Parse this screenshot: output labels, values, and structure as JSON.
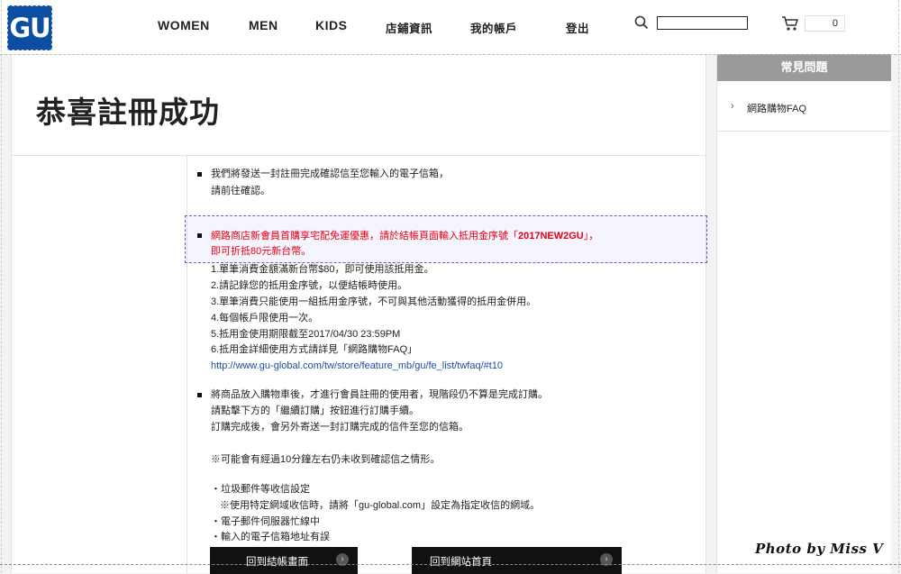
{
  "header": {
    "logo": "GU",
    "nav": [
      "WOMEN",
      "MEN",
      "KIDS",
      "店鋪資訊",
      "我的帳戶",
      "登出"
    ],
    "search_placeholder": "",
    "cart_count": "0"
  },
  "page_title": "恭喜註冊成功",
  "notice1": {
    "lines": [
      "我們將發送一封註冊完成確認信至您輸入的電子信箱，",
      "請前往確認。"
    ]
  },
  "promo": {
    "line1_prefix": "網路商店新會員首購享宅配免運優惠，請於結帳頁面輸入抵用金序號「",
    "code": "2017NEW2GU",
    "line1_suffix": "」，",
    "line2": "即可折抵80元新台幣。"
  },
  "rules": [
    "1.單筆消費金額滿新台幣$80，即可使用該抵用金。",
    "2.請記錄您的抵用金序號，以便結帳時使用。",
    "3.單筆消費只能使用一組抵用金序號，不可與其他活動獲得的抵用金併用。",
    "4.每個帳戶限使用一次。",
    "5.抵用金使用期限截至2017/04/30 23:59PM",
    "6.抵用金詳細使用方式請詳見「網路購物FAQ」"
  ],
  "faq_link": "http://www.gu-global.com/tw/store/feature_mb/gu/fe_list/twfaq/#t10",
  "notice3": {
    "lines": [
      "將商品放入購物車後，才進行會員註冊的使用者，現階段仍不算是完成訂購。",
      "請點擊下方的「繼續訂購」按鈕進行訂購手續。",
      "訂購完成後，會另外寄送一封訂購完成的信件至您的信箱。"
    ]
  },
  "warning": "※可能會有經過10分鐘左右仍未收到確認信之情形。",
  "reasons": [
    "・垃圾郵件等收信設定",
    "※使用特定網域收信時，請將「gu-global.com」設定為指定收信的網域。",
    "・電子郵件伺服器忙線中",
    "・輸入的電子信箱地址有誤"
  ],
  "buttons": {
    "back_checkout": "回到結帳畫面",
    "back_home": "回到網站首頁"
  },
  "sidebar": {
    "header": "常見問題",
    "item": "網路購物FAQ"
  },
  "watermark": "Photo by Miss V",
  "colors": {
    "brand": "#0b4ea2",
    "promo_red": "#e60012",
    "link": "#1a4fa0"
  },
  "icons": [
    "search-icon",
    "cart-icon",
    "chevron-right-icon"
  ]
}
